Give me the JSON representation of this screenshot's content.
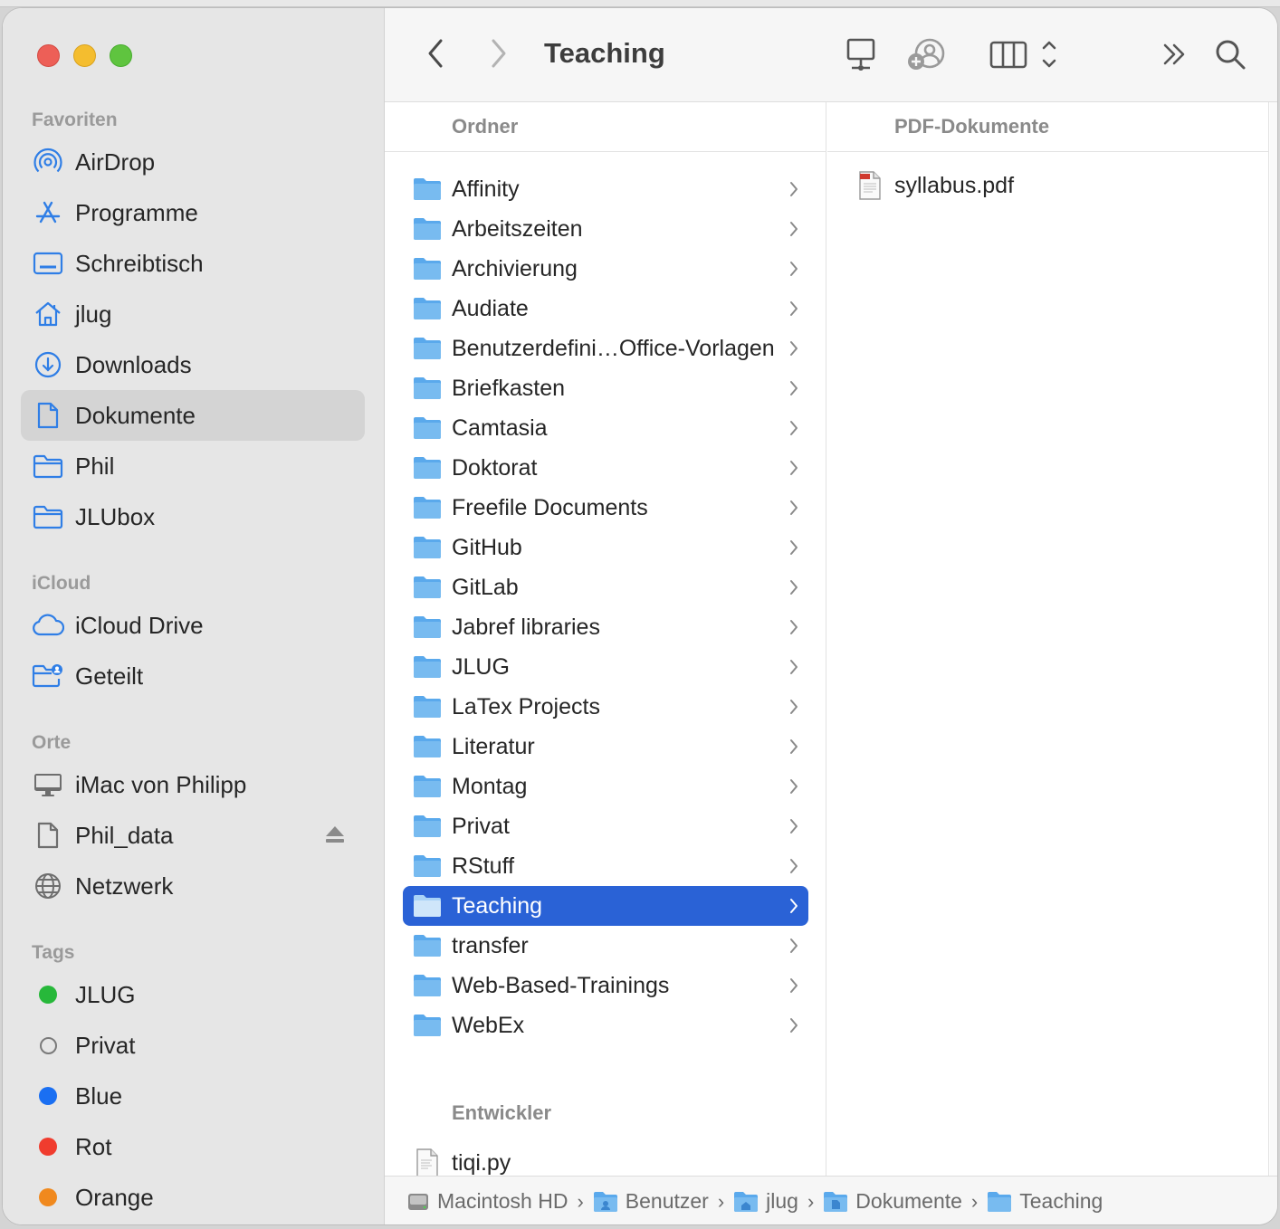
{
  "window": {
    "title": "Teaching"
  },
  "sidebar": {
    "favorites_title": "Favoriten",
    "favorites": [
      {
        "label": "AirDrop",
        "icon": "airdrop-icon"
      },
      {
        "label": "Programme",
        "icon": "applications-icon"
      },
      {
        "label": "Schreibtisch",
        "icon": "desktop-icon"
      },
      {
        "label": "jlug",
        "icon": "home-icon"
      },
      {
        "label": "Downloads",
        "icon": "downloads-icon"
      },
      {
        "label": "Dokumente",
        "icon": "document-icon",
        "selected": true
      },
      {
        "label": "Phil",
        "icon": "folder-icon"
      },
      {
        "label": "JLUbox",
        "icon": "folder-icon"
      }
    ],
    "icloud_title": "iCloud",
    "icloud": [
      {
        "label": "iCloud Drive",
        "icon": "cloud-icon"
      },
      {
        "label": "Geteilt",
        "icon": "shared-folder-icon"
      }
    ],
    "places_title": "Orte",
    "places": [
      {
        "label": "iMac von Philipp",
        "icon": "computer-icon"
      },
      {
        "label": "Phil_data",
        "icon": "drive-icon"
      },
      {
        "label": "Netzwerk",
        "icon": "network-icon"
      }
    ],
    "tags_title": "Tags",
    "tags": [
      {
        "label": "JLUG",
        "color": "#27b83a"
      },
      {
        "label": "Privat",
        "color": "none"
      },
      {
        "label": "Blue",
        "color": "#1a6ff2"
      },
      {
        "label": "Rot",
        "color": "#f03c2e"
      },
      {
        "label": "Orange",
        "color": "#f0891e"
      }
    ]
  },
  "column1": {
    "header": "Ordner",
    "folders": [
      "Affinity",
      "Arbeitszeiten",
      "Archivierung",
      "Audiate",
      "Benutzerdefini…Office-Vorlagen",
      "Briefkasten",
      "Camtasia",
      "Doktorat",
      "Freefile Documents",
      "GitHub",
      "GitLab",
      "Jabref libraries",
      "JLUG",
      "LaTex Projects",
      "Literatur",
      "Montag",
      "Privat",
      "RStuff",
      "Teaching",
      "transfer",
      "Web-Based-Trainings",
      "WebEx"
    ],
    "selected": "Teaching",
    "section2_header": "Entwickler",
    "files": [
      "tiqi.py"
    ]
  },
  "column2": {
    "header": "PDF-Dokumente",
    "files": [
      "syllabus.pdf"
    ]
  },
  "pathbar": {
    "items": [
      "Macintosh HD",
      "Benutzer",
      "jlug",
      "Dokumente",
      "Teaching"
    ],
    "separator": "›"
  },
  "colors": {
    "accent": "#2a62d6",
    "folder": "#5aa9ec"
  }
}
